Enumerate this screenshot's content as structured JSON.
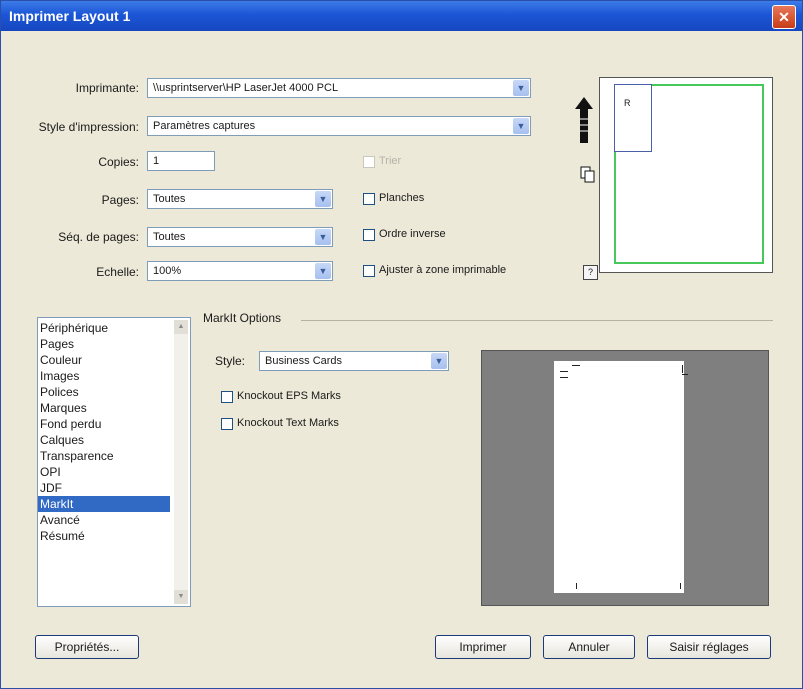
{
  "window": {
    "title": "Imprimer Layout 1",
    "close_icon": "close-icon"
  },
  "labels": {
    "printer": "Imprimante:",
    "print_style": "Style d'impression:",
    "copies": "Copies:",
    "pages": "Pages:",
    "page_sequence": "Séq. de pages:",
    "scale": "Echelle:"
  },
  "values": {
    "printer": "\\\\usprintserver\\HP LaserJet 4000 PCL",
    "print_style": "Paramètres captures",
    "copies": "1",
    "pages": "Toutes",
    "page_sequence": "Toutes",
    "scale": "100%"
  },
  "checkboxes": {
    "collate": "Trier",
    "spreads": "Planches",
    "reverse_order": "Ordre inverse",
    "fit_printable": "Ajuster à zone imprimable"
  },
  "preview_top": {
    "label": "R"
  },
  "categories": [
    "Périphérique",
    "Pages",
    "Couleur",
    "Images",
    "Polices",
    "Marques",
    "Fond perdu",
    "Calques",
    "Transparence",
    "OPI",
    "JDF",
    "MarkIt",
    "Avancé",
    "Résumé"
  ],
  "selected_category": "MarkIt",
  "markit": {
    "section_title": "MarkIt Options",
    "style_label": "Style:",
    "style_value": "Business Cards",
    "knockout_eps": "Knockout EPS Marks",
    "knockout_text": "Knockout Text Marks"
  },
  "buttons": {
    "properties": "Propriétés...",
    "print": "Imprimer",
    "cancel": "Annuler",
    "capture": "Saisir réglages"
  },
  "colors": {
    "title_bar": "#1c56d6",
    "selection": "#316ac5",
    "preview_border": "#46c85a"
  }
}
